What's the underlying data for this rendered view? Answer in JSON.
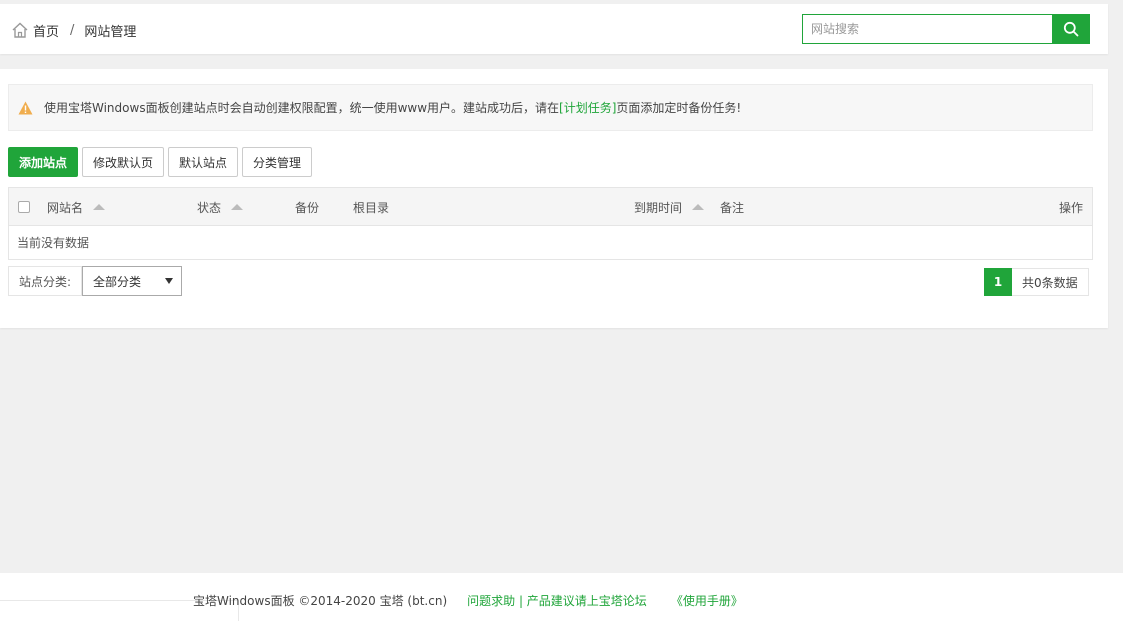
{
  "header": {
    "breadcrumb_home": "首页",
    "breadcrumb_sep": "/",
    "breadcrumb_current": "网站管理",
    "search_placeholder": "网站搜索"
  },
  "alert": {
    "text_before": "使用宝塔Windows面板创建站点时会自动创建权限配置，统一使用www用户。建站成功后，请在",
    "link": "[计划任务]",
    "text_after": "页面添加定时备份任务!"
  },
  "toolbar": {
    "add_site": "添加站点",
    "edit_default_page": "修改默认页",
    "default_site": "默认站点",
    "category_manage": "分类管理"
  },
  "table": {
    "columns": {
      "name": "网站名",
      "status": "状态",
      "backup": "备份",
      "root": "根目录",
      "expire": "到期时间",
      "note": "备注",
      "ops": "操作"
    },
    "empty_text": "当前没有数据"
  },
  "filter": {
    "label": "站点分类:",
    "selected": "全部分类"
  },
  "pager": {
    "current_page": "1",
    "total_text": "共0条数据"
  },
  "footer": {
    "copyright": "宝塔Windows面板 ©2014-2020 宝塔 (bt.cn)",
    "help_link": "问题求助 | 产品建议请上宝塔论坛",
    "manual_link": "《使用手册》"
  },
  "colors": {
    "accent": "#20a53a",
    "warning": "#f0ad4e"
  }
}
